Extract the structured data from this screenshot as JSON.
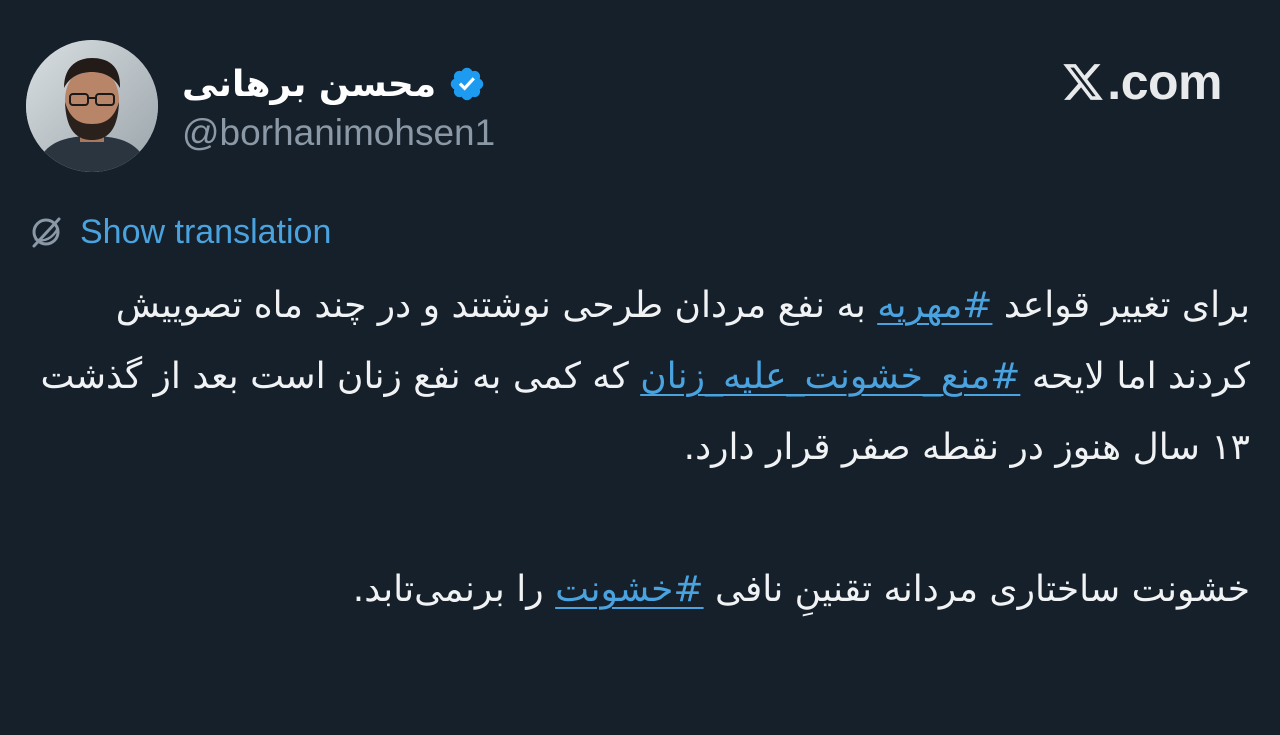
{
  "author": {
    "display_name": "محسن برهانی",
    "handle": "@borhanimohsen1",
    "verified": true
  },
  "brand": {
    "icon": "x-logo-icon",
    "text": ".com"
  },
  "translate": {
    "icon": "globe-icon",
    "label": "Show translation"
  },
  "tweet": {
    "p1": {
      "t1": "برای تغییر قواعد ",
      "h1": "#مهریه",
      "t2": " به نفع مردان طرحی نوشتند و در چند ماه تصوییش کردند اما لایحه ",
      "h2": "#منع_خشونت_علیه_زنان",
      "t3": " که کمی به نفع زنان است بعد از گذشت ۱۳ سال هنوز در نقطه صفر قرار دارد."
    },
    "p2": {
      "t1": "خشونت ساختاری مردانه تقنینِ نافی ",
      "h1": "#خشونت",
      "t2": " را برنمی‌تابد."
    }
  },
  "colors": {
    "background": "#15202b",
    "link": "#4aa3df",
    "secondary_text": "#8b98a5",
    "verified_badge": "#1d9bf0"
  }
}
